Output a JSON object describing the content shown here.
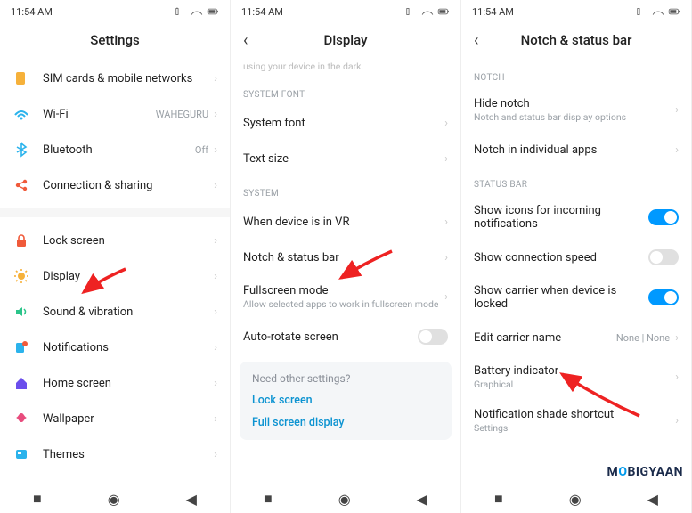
{
  "status": {
    "time": "11:54 AM"
  },
  "screen1": {
    "title": "Settings",
    "rows": [
      {
        "icon": "sim",
        "label": "SIM cards & mobile networks"
      },
      {
        "icon": "wifi",
        "label": "Wi-Fi",
        "value": "WAHEGURU"
      },
      {
        "icon": "bt",
        "label": "Bluetooth",
        "value": "Off"
      },
      {
        "icon": "share",
        "label": "Connection & sharing"
      }
    ],
    "rows2": [
      {
        "icon": "lock",
        "label": "Lock screen"
      },
      {
        "icon": "display",
        "label": "Display"
      },
      {
        "icon": "sound",
        "label": "Sound & vibration"
      },
      {
        "icon": "notif",
        "label": "Notifications"
      },
      {
        "icon": "home",
        "label": "Home screen"
      },
      {
        "icon": "wall",
        "label": "Wallpaper"
      },
      {
        "icon": "theme",
        "label": "Themes"
      }
    ]
  },
  "screen2": {
    "title": "Display",
    "topfade": "using your device in the dark.",
    "sec_font": "SYSTEM FONT",
    "sysfont": "System font",
    "textsize": "Text size",
    "sec_sys": "SYSTEM",
    "vr": "When device is in VR",
    "notch": "Notch & status bar",
    "fullscreen": "Fullscreen mode",
    "fullscreen_sub": "Allow selected apps to work in fullscreen mode",
    "autorotate": "Auto-rotate screen",
    "need_q": "Need other settings?",
    "need_lock": "Lock screen",
    "need_full": "Full screen display"
  },
  "screen3": {
    "title": "Notch & status bar",
    "sec_notch": "NOTCH",
    "hide": "Hide notch",
    "hide_sub": "Notch and status bar display options",
    "indiv": "Notch in individual apps",
    "sec_status": "STATUS BAR",
    "icons_incoming": "Show icons for incoming notifications",
    "conn_speed": "Show connection speed",
    "carrier_lock": "Show carrier when device is locked",
    "edit_carrier": "Edit carrier name",
    "edit_carrier_val": "None | None",
    "battery": "Battery indicator",
    "battery_sub": "Graphical",
    "shade": "Notification shade shortcut",
    "shade_sub": "Settings"
  },
  "watermark": "MOBIGYAAN"
}
